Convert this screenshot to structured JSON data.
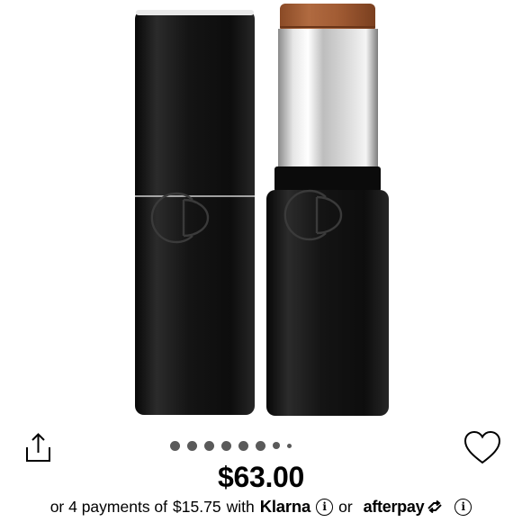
{
  "product": {
    "image_alt": "Dior foundation stick, capped and uncapped",
    "logo_text": "CD",
    "stick_color": "#a8613a",
    "case_color": "#161616"
  },
  "actions": {
    "share_icon": "share-icon",
    "favorite_icon": "heart-outline-icon"
  },
  "carousel": {
    "count": 8,
    "active_index": 0
  },
  "price": {
    "amount": "$63.00"
  },
  "payment": {
    "prefix": "or 4 payments of",
    "installment": "$15.75",
    "with": "with",
    "klarna": "Klarna",
    "or": "or",
    "afterpay": "afterpay"
  }
}
